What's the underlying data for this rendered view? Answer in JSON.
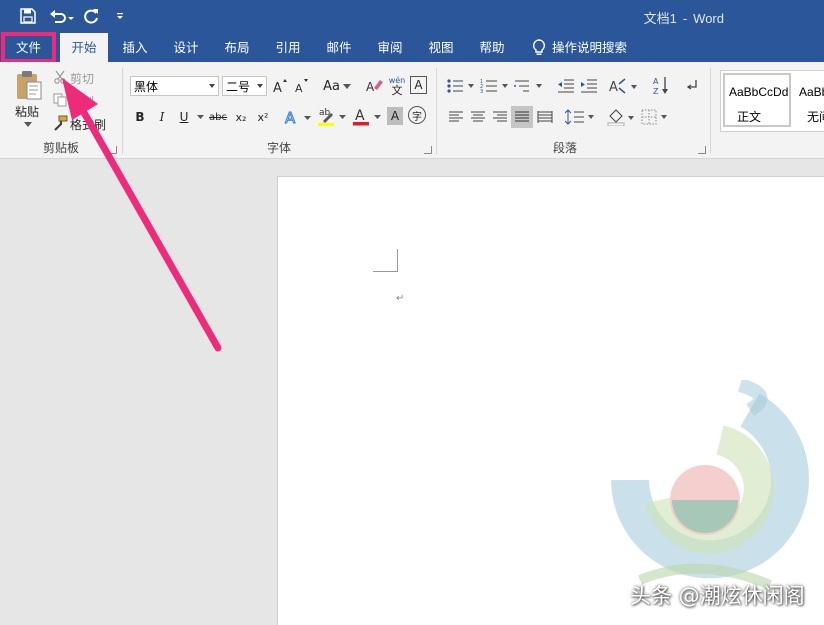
{
  "titlebar": {
    "doc_name": "文档1",
    "separator": "-",
    "app_name": "Word",
    "bg_color": "#2b579a"
  },
  "tabs": [
    {
      "label": "文件",
      "highlighted": true
    },
    {
      "label": "开始",
      "active": true
    },
    {
      "label": "插入"
    },
    {
      "label": "设计"
    },
    {
      "label": "布局"
    },
    {
      "label": "引用"
    },
    {
      "label": "邮件"
    },
    {
      "label": "审阅"
    },
    {
      "label": "视图"
    },
    {
      "label": "帮助"
    },
    {
      "label": "操作说明搜索"
    }
  ],
  "clipboard": {
    "paste": "粘贴",
    "cut": "剪切",
    "copy": "复制",
    "format_painter": "格式刷",
    "group_label": "剪贴板"
  },
  "font": {
    "font_name": "黑体",
    "font_size": "二号",
    "change_case": "Aa",
    "phonetic_top": "wén",
    "phonetic_bottom": "文",
    "border_char": "A",
    "bold": "B",
    "italic": "I",
    "underline": "U",
    "strikethrough": "abc",
    "subscript": "x₂",
    "superscript": "x²",
    "shading_char": "A",
    "enclose_char": "字",
    "group_label": "字体"
  },
  "paragraph": {
    "group_label": "段落"
  },
  "styles": {
    "items": [
      {
        "sample": "AaBbCcDd",
        "name": "正文"
      },
      {
        "sample": "AaBbCcDd",
        "name": "无间隔"
      }
    ]
  },
  "watermark": {
    "text": "头条 @潮炫休闲阁"
  },
  "annotation": {
    "highlight_color": "#ee2a7b"
  }
}
